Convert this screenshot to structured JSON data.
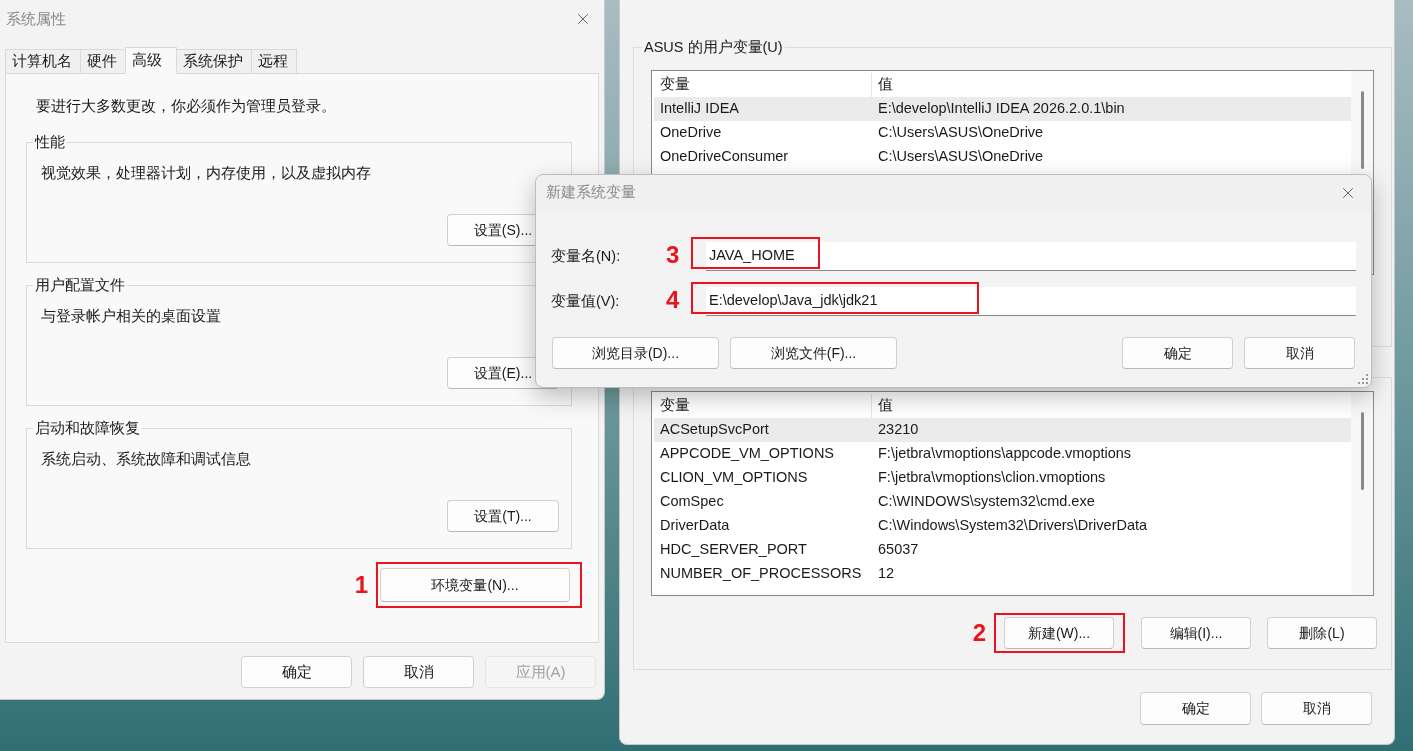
{
  "system_properties": {
    "title": "系统属性",
    "tabs": [
      {
        "label": "计算机名",
        "selected": false
      },
      {
        "label": "硬件",
        "selected": false
      },
      {
        "label": "高级",
        "selected": true
      },
      {
        "label": "系统保护",
        "selected": false
      },
      {
        "label": "远程",
        "selected": false
      }
    ],
    "notice": "要进行大多数更改，你必须作为管理员登录。",
    "groups": [
      {
        "title": "性能",
        "description": "视觉效果，处理器计划，内存使用，以及虚拟内存",
        "button": "设置(S)..."
      },
      {
        "title": "用户配置文件",
        "description": "与登录帐户相关的桌面设置",
        "button": "设置(E)..."
      },
      {
        "title": "启动和故障恢复",
        "description": "系统启动、系统故障和调试信息",
        "button": "设置(T)..."
      }
    ],
    "env_button": {
      "label": "环境变量(N)...",
      "step": "1"
    },
    "footer_buttons": [
      {
        "label": "确定",
        "disabled": false
      },
      {
        "label": "取消",
        "disabled": false
      },
      {
        "label": "应用(A)",
        "disabled": true
      }
    ]
  },
  "environment_variables": {
    "user_group_title": "ASUS 的用户变量(U)",
    "user_table": {
      "columns": [
        "变量",
        "值"
      ],
      "rows": [
        {
          "name": "IntelliJ IDEA",
          "value": "E:\\develop\\IntelliJ IDEA 2026.2.0.1\\bin",
          "selected": true
        },
        {
          "name": "OneDrive",
          "value": "C:\\Users\\ASUS\\OneDrive",
          "selected": false
        },
        {
          "name": "OneDriveConsumer",
          "value": "C:\\Users\\ASUS\\OneDrive",
          "selected": false
        }
      ]
    },
    "system_table": {
      "columns": [
        "变量",
        "值"
      ],
      "rows": [
        {
          "name": "ACSetupSvcPort",
          "value": "23210",
          "selected": true
        },
        {
          "name": "APPCODE_VM_OPTIONS",
          "value": "F:\\jetbra\\vmoptions\\appcode.vmoptions",
          "selected": false
        },
        {
          "name": "CLION_VM_OPTIONS",
          "value": "F:\\jetbra\\vmoptions\\clion.vmoptions",
          "selected": false
        },
        {
          "name": "ComSpec",
          "value": "C:\\WINDOWS\\system32\\cmd.exe",
          "selected": false
        },
        {
          "name": "DriverData",
          "value": "C:\\Windows\\System32\\Drivers\\DriverData",
          "selected": false
        },
        {
          "name": "HDC_SERVER_PORT",
          "value": "65037",
          "selected": false
        },
        {
          "name": "NUMBER_OF_PROCESSORS",
          "value": "12",
          "selected": false
        }
      ]
    },
    "system_buttons": [
      {
        "label": "新建(W)...",
        "step": "2"
      },
      {
        "label": "编辑(I)..."
      },
      {
        "label": "删除(L)"
      }
    ],
    "footer_buttons": [
      "确定",
      "取消"
    ]
  },
  "new_variable_dialog": {
    "title": "新建系统变量",
    "fields": [
      {
        "label": "变量名(N):",
        "value": "JAVA_HOME",
        "step": "3"
      },
      {
        "label": "变量值(V):",
        "value": "E:\\develop\\Java_jdk\\jdk21",
        "step": "4"
      }
    ],
    "browse_buttons": [
      "浏览目录(D)...",
      "浏览文件(F)..."
    ],
    "buttons": [
      "确定",
      "取消"
    ]
  }
}
